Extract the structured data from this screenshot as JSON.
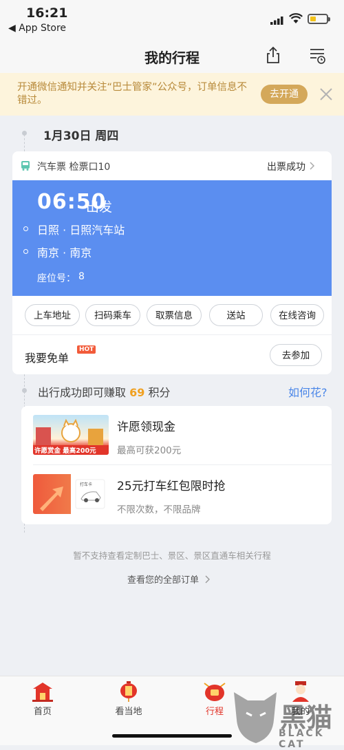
{
  "status_bar": {
    "time": "16:21",
    "back_app": "◀ App Store"
  },
  "nav": {
    "title": "我的行程",
    "share_icon": "share-icon",
    "list_icon": "order-list-icon"
  },
  "banner": {
    "text": "开通微信通知并关注“巴士管家”公众号，订单信息不错过。",
    "button": "去开通",
    "close_icon": "close-icon"
  },
  "trip": {
    "date": "1月30日 周四",
    "ticket_type": "汽车票 检票口10",
    "status": "出票成功",
    "depart_time": "06:50",
    "depart_label": "出发",
    "from": "日照 · 日照汽车站",
    "to": "南京 · 南京",
    "seat_label": "座位号：",
    "seat_value": "8",
    "actions": [
      "上车地址",
      "扫码乘车",
      "取票信息",
      "送站",
      "在线咨询"
    ],
    "free_label": "我要免单",
    "hot_badge": "HOT",
    "join_button": "去参加"
  },
  "points": {
    "prefix": "出行成功即可赚取",
    "value": "69",
    "suffix": "积分",
    "link": "如何花?"
  },
  "promos": [
    {
      "title": "许愿领现金",
      "subtitle": "最高可获200元",
      "img_text": "许愿赏金 最高200元"
    },
    {
      "title": "25元打车红包限时抢",
      "subtitle": "不限次数，不限品牌",
      "img_text": "打车卡"
    }
  ],
  "note": "暂不支持查看定制巴士、景区、景区直通车相关行程",
  "all_orders": "查看您的全部订单",
  "tabs": [
    {
      "label": "首页",
      "icon": "home-temple-icon"
    },
    {
      "label": "看当地",
      "icon": "lantern-icon"
    },
    {
      "label": "行程",
      "icon": "trip-bag-icon",
      "active": true
    },
    {
      "label": "我的",
      "icon": "profile-icon"
    }
  ],
  "watermark": {
    "text": "黑猫",
    "sub": "BLACK CAT"
  },
  "colors": {
    "accent_blue": "#5b8ef0",
    "banner_bg": "#fdf4dc",
    "banner_button": "#d4a85a",
    "points_orange": "#f0a020",
    "link_blue": "#4a86e8"
  }
}
